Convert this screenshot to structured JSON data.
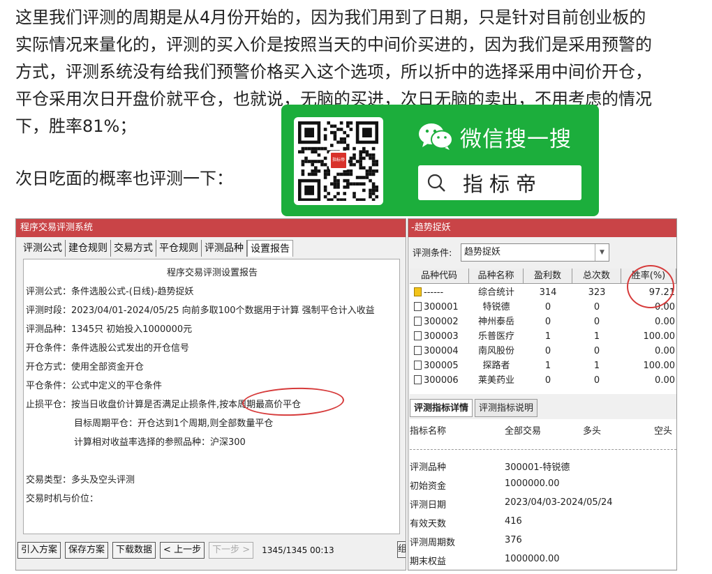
{
  "article": {
    "paragraph_1": "这里我们评测的周期是从4月份开始的，因为我们用到了日期，只是针对目前创业板的\n实际情况来量化的，评测的买入价是按照当天的中间价买进的，因为我们是采用预警的\n方式，评测系统没有给我们预警价格买入这个选项，所以折中的选择采用中间价开仓，\n平仓采用次日开盘价就平仓，也就说，无脑的买进，次日无脑的卖出，不用考虑的情况\n下，胜率81%；",
    "paragraph_2": "次日吃面的概率也评测一下："
  },
  "promo": {
    "wechat_text": "微信搜一搜",
    "search_text": "指标帝",
    "qr_logo_text": "指标帝",
    "colors": {
      "green": "#1cae3c"
    }
  },
  "dialog": {
    "title": "程序交易评测系统",
    "tabs": [
      "评测公式",
      "建仓规则",
      "交易方式",
      "平仓规则",
      "评测品种",
      "设置报告"
    ],
    "report": {
      "title": "程序交易评测设置报告",
      "formula": "评测公式：条件选股公式-(日线)-趋势捉妖",
      "period": "评测时段：2023/04/01-2024/05/25 向前多取100个数据用于计算 强制平仓计入收益",
      "varieties": "评测品种：1345只 初始投入1000000元",
      "open_cond": "开仓条件：条件选股公式发出的开仓信号",
      "open_method": "开仓方式：使用全部资金开仓",
      "close_cond": "平仓条件：公式中定义的平仓条件",
      "stop_loss": "止损平仓：按当日收盘价计算是否满足止损条件,按本周期最高价平仓",
      "target_period": "目标周期平仓：开仓达到1个周期,则全部数量平仓",
      "benchmark": "计算相对收益率选择的参照品种：沪深300",
      "trade_type": "交易类型：多头及空头评测",
      "trade_timing": "交易时机与价位："
    },
    "buttons": {
      "import": "引入方案",
      "save": "保存方案",
      "download": "下载数据",
      "prev": "< 上一步",
      "next": "下一步 >",
      "counter": "1345/1345 00:13",
      "clipped": "组"
    }
  },
  "panel": {
    "title": "-趋势捉妖",
    "condition_label": "评测条件:",
    "condition_value": "趋势捉妖",
    "columns": [
      "品种代码",
      "品种名称",
      "盈利数",
      "总次数",
      "胜率(%)"
    ],
    "rows": [
      {
        "code": "------",
        "name": "综合统计",
        "profit": "314",
        "total": "323",
        "rate": "97.21"
      },
      {
        "code": "300001",
        "name": "特锐德",
        "profit": "0",
        "total": "0",
        "rate": "0.00"
      },
      {
        "code": "300002",
        "name": "神州泰岳",
        "profit": "0",
        "total": "0",
        "rate": "0.00"
      },
      {
        "code": "300003",
        "name": "乐普医疗",
        "profit": "1",
        "total": "1",
        "rate": "100.00"
      },
      {
        "code": "300004",
        "name": "南风股份",
        "profit": "0",
        "total": "0",
        "rate": "0.00"
      },
      {
        "code": "300005",
        "name": "探路者",
        "profit": "1",
        "total": "1",
        "rate": "100.00"
      },
      {
        "code": "300006",
        "name": "莱美药业",
        "profit": "0",
        "total": "0",
        "rate": "0.00"
      }
    ],
    "subtabs": [
      "评测指标详情",
      "评测指标说明"
    ],
    "detail_headers": [
      "指标名称",
      "全部交易",
      "多头",
      "空头"
    ],
    "details": [
      {
        "key": "评测品种",
        "value": "300001-特锐德"
      },
      {
        "key": "初始资金",
        "value": "1000000.00"
      },
      {
        "key": "评测日期",
        "value": "2023/04/03-2024/05/24"
      },
      {
        "key": "有效天数",
        "value": "416"
      },
      {
        "key": "评测周期数",
        "value": "376"
      },
      {
        "key": "期末权益",
        "value": "1000000.00"
      }
    ]
  },
  "annotation_color": "#d63a3a"
}
